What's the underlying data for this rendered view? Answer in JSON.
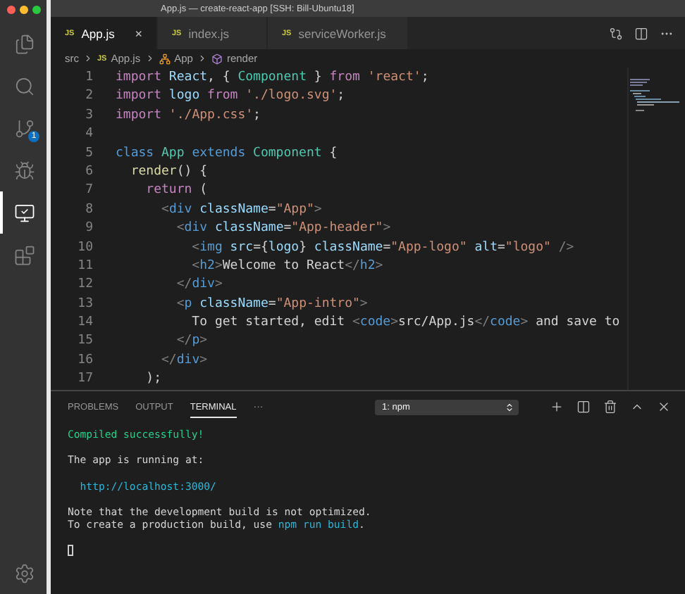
{
  "window": {
    "title": "App.js — create-react-app [SSH: Bill-Ubuntu18]"
  },
  "activity_bar": [
    {
      "kind": "explorer",
      "selected": false
    },
    {
      "kind": "search",
      "selected": false
    },
    {
      "kind": "source_control",
      "selected": false,
      "badge": "1"
    },
    {
      "kind": "debug",
      "selected": false
    },
    {
      "kind": "remote",
      "selected": true
    },
    {
      "kind": "extensions",
      "selected": false
    }
  ],
  "tabs": [
    {
      "badge": "JS",
      "label": "App.js",
      "selected": true,
      "close": "×"
    },
    {
      "badge": "JS",
      "label": "index.js",
      "selected": false
    },
    {
      "badge": "JS",
      "label": "serviceWorker.js",
      "selected": false
    }
  ],
  "breadcrumb": [
    {
      "kind": "folder",
      "label": "src"
    },
    {
      "kind": "file",
      "badge": "JS",
      "label": "App.js"
    },
    {
      "kind": "class",
      "label": "App"
    },
    {
      "kind": "method",
      "label": "render"
    }
  ],
  "code": [
    {
      "number": "1",
      "tokens": [
        {
          "kind": "keyword",
          "text": "import"
        },
        {
          "kind": "variable",
          "text": " React"
        },
        {
          "kind": "plain",
          "text": ", { "
        },
        {
          "kind": "type",
          "text": "Component"
        },
        {
          "kind": "plain",
          "text": " } "
        },
        {
          "kind": "keyword",
          "text": "from"
        },
        {
          "kind": "string",
          "text": " 'react'"
        },
        {
          "kind": "plain",
          "text": ";"
        }
      ]
    },
    {
      "number": "2",
      "tokens": [
        {
          "kind": "keyword",
          "text": "import"
        },
        {
          "kind": "variable",
          "text": " logo "
        },
        {
          "kind": "keyword",
          "text": "from"
        },
        {
          "kind": "string",
          "text": " './logo.svg'"
        },
        {
          "kind": "plain",
          "text": ";"
        }
      ]
    },
    {
      "number": "3",
      "tokens": [
        {
          "kind": "keyword",
          "text": "import"
        },
        {
          "kind": "string",
          "text": " './App.css'"
        },
        {
          "kind": "plain",
          "text": ";"
        }
      ]
    },
    {
      "number": "4"
    },
    {
      "number": "5",
      "tokens": [
        {
          "kind": "storage",
          "text": "class"
        },
        {
          "kind": "type",
          "text": " App "
        },
        {
          "kind": "storage",
          "text": "extends"
        },
        {
          "kind": "type",
          "text": " Component"
        },
        {
          "kind": "plain",
          "text": " {"
        }
      ]
    },
    {
      "number": "6",
      "tokens": [
        {
          "kind": "function",
          "text": "  render"
        },
        {
          "kind": "plain",
          "text": "() {"
        }
      ]
    },
    {
      "number": "7",
      "tokens": [
        {
          "kind": "keyword",
          "text": "    return"
        },
        {
          "kind": "plain",
          "text": " ("
        }
      ]
    },
    {
      "number": "8",
      "tokens": [
        {
          "kind": "punct",
          "text": "      <"
        },
        {
          "kind": "tag",
          "text": "div"
        },
        {
          "kind": "attr",
          "text": " className"
        },
        {
          "kind": "plain",
          "text": "="
        },
        {
          "kind": "string",
          "text": "\"App\""
        },
        {
          "kind": "punct",
          "text": ">"
        }
      ]
    },
    {
      "number": "9",
      "tokens": [
        {
          "kind": "punct",
          "text": "        <"
        },
        {
          "kind": "tag",
          "text": "div"
        },
        {
          "kind": "attr",
          "text": " className"
        },
        {
          "kind": "plain",
          "text": "="
        },
        {
          "kind": "string",
          "text": "\"App-header\""
        },
        {
          "kind": "punct",
          "text": ">"
        }
      ]
    },
    {
      "number": "10",
      "tokens": [
        {
          "kind": "punct",
          "text": "          <"
        },
        {
          "kind": "tag",
          "text": "img"
        },
        {
          "kind": "attr",
          "text": " src"
        },
        {
          "kind": "plain",
          "text": "={"
        },
        {
          "kind": "variable",
          "text": "logo"
        },
        {
          "kind": "plain",
          "text": "}"
        },
        {
          "kind": "attr",
          "text": " className"
        },
        {
          "kind": "plain",
          "text": "="
        },
        {
          "kind": "string",
          "text": "\"App-logo\""
        },
        {
          "kind": "attr",
          "text": " alt"
        },
        {
          "kind": "plain",
          "text": "="
        },
        {
          "kind": "string",
          "text": "\"logo\""
        },
        {
          "kind": "punct",
          "text": " />"
        }
      ]
    },
    {
      "number": "11",
      "tokens": [
        {
          "kind": "punct",
          "text": "          <"
        },
        {
          "kind": "tag",
          "text": "h2"
        },
        {
          "kind": "punct",
          "text": ">"
        },
        {
          "kind": "plain",
          "text": "Welcome to React"
        },
        {
          "kind": "punct",
          "text": "</"
        },
        {
          "kind": "tag",
          "text": "h2"
        },
        {
          "kind": "punct",
          "text": ">"
        }
      ]
    },
    {
      "number": "12",
      "tokens": [
        {
          "kind": "punct",
          "text": "        </"
        },
        {
          "kind": "tag",
          "text": "div"
        },
        {
          "kind": "punct",
          "text": ">"
        }
      ]
    },
    {
      "number": "13",
      "tokens": [
        {
          "kind": "punct",
          "text": "        <"
        },
        {
          "kind": "tag",
          "text": "p"
        },
        {
          "kind": "attr",
          "text": " className"
        },
        {
          "kind": "plain",
          "text": "="
        },
        {
          "kind": "string",
          "text": "\"App-intro\""
        },
        {
          "kind": "punct",
          "text": ">"
        }
      ]
    },
    {
      "number": "14",
      "tokens": [
        {
          "kind": "plain",
          "text": "          To get started, edit "
        },
        {
          "kind": "punct",
          "text": "<"
        },
        {
          "kind": "tag",
          "text": "code"
        },
        {
          "kind": "punct",
          "text": ">"
        },
        {
          "kind": "plain",
          "text": "src/App.js"
        },
        {
          "kind": "punct",
          "text": "</"
        },
        {
          "kind": "tag",
          "text": "code"
        },
        {
          "kind": "punct",
          "text": ">"
        },
        {
          "kind": "plain",
          "text": " and save to"
        }
      ]
    },
    {
      "number": "15",
      "tokens": [
        {
          "kind": "punct",
          "text": "        </"
        },
        {
          "kind": "tag",
          "text": "p"
        },
        {
          "kind": "punct",
          "text": ">"
        }
      ]
    },
    {
      "number": "16",
      "tokens": [
        {
          "kind": "punct",
          "text": "      </"
        },
        {
          "kind": "tag",
          "text": "div"
        },
        {
          "kind": "punct",
          "text": ">"
        }
      ]
    },
    {
      "number": "17",
      "tokens": [
        {
          "kind": "plain",
          "text": "    );"
        }
      ]
    }
  ],
  "panel": {
    "tabs": [
      {
        "label": "PROBLEMS",
        "selected": false
      },
      {
        "label": "OUTPUT",
        "selected": false
      },
      {
        "label": "TERMINAL",
        "selected": true
      }
    ],
    "more": "···",
    "terminal_select": "1: npm",
    "terminal": [
      {
        "lines": [
          {
            "tokens": [
              {
                "kind": "success",
                "text": "Compiled successfully!"
              }
            ]
          }
        ]
      },
      {
        "lines": [
          {
            "tokens": [
              {
                "kind": "plain",
                "text": "The app is running at:"
              }
            ]
          }
        ]
      },
      {
        "lines": [
          {
            "tokens": [
              {
                "kind": "link",
                "text": "  http://localhost:3000/"
              }
            ]
          }
        ]
      },
      {
        "lines": [
          {
            "tokens": [
              {
                "kind": "plain",
                "text": "Note that the development build is not optimized."
              }
            ]
          },
          {
            "tokens": [
              {
                "kind": "plain",
                "text": "To create a production build, use "
              },
              {
                "kind": "link",
                "text": "npm run build"
              },
              {
                "kind": "plain",
                "text": "."
              }
            ]
          }
        ]
      }
    ],
    "cursor": true
  }
}
